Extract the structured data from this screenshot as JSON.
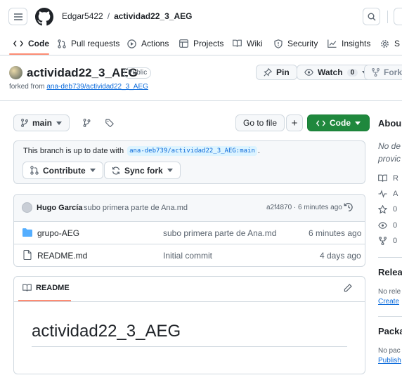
{
  "header": {
    "owner": "Edgar5422",
    "separator": "/",
    "repo": "actividad22_3_AEG"
  },
  "nav": {
    "tabs": [
      {
        "label": "Code",
        "icon": "code-icon"
      },
      {
        "label": "Pull requests",
        "icon": "pull-request-icon"
      },
      {
        "label": "Actions",
        "icon": "play-icon"
      },
      {
        "label": "Projects",
        "icon": "table-icon"
      },
      {
        "label": "Wiki",
        "icon": "book-icon"
      },
      {
        "label": "Security",
        "icon": "shield-icon"
      },
      {
        "label": "Insights",
        "icon": "graph-icon"
      },
      {
        "label": "S",
        "icon": "gear-icon"
      }
    ]
  },
  "repo": {
    "name": "actividad22_3_AEG",
    "visibility": "Public",
    "forked_prefix": "forked from ",
    "forked_link": "ana-deb739/actividad22_3_AEG",
    "pin_label": "Pin",
    "watch_label": "Watch",
    "watch_count": "0",
    "fork_label": "Fork"
  },
  "toolbar": {
    "branch": "main",
    "goto_file": "Go to file",
    "add": "+",
    "code": "Code"
  },
  "branch_status": {
    "prefix": "This branch is up to date with",
    "ref": "ana-deb739/actividad22_3_AEG:main",
    "suffix": ".",
    "contribute": "Contribute",
    "sync_fork": "Sync fork"
  },
  "commit": {
    "author": "Hugo García",
    "message": "subo primera parte de Ana.md",
    "hash_time": "a2f4870 · 6 minutes ago"
  },
  "files": [
    {
      "name": "grupo-AEG",
      "type": "folder",
      "message": "subo primera parte de Ana.md",
      "time": "6 minutes ago"
    },
    {
      "name": "README.md",
      "type": "file",
      "message": "Initial commit",
      "time": "4 days ago"
    }
  ],
  "readme": {
    "tab": "README",
    "heading": "actividad22_3_AEG"
  },
  "sidebar": {
    "about_title": "Abou",
    "about_desc_1": "No de",
    "about_desc_2": "provic",
    "stats": [
      "R",
      "A",
      "0",
      "0",
      "0"
    ],
    "releases_title": "Relea",
    "releases_text": "No rele",
    "releases_link": "Create",
    "packages_title": "Packa",
    "packages_text": "No pac",
    "packages_link": "Publish"
  },
  "colors": {
    "accent": "#0969da",
    "primary_green": "#1f883d",
    "tab_underline": "#fd8c73",
    "border": "#d1d9e0",
    "muted": "#59636e"
  }
}
